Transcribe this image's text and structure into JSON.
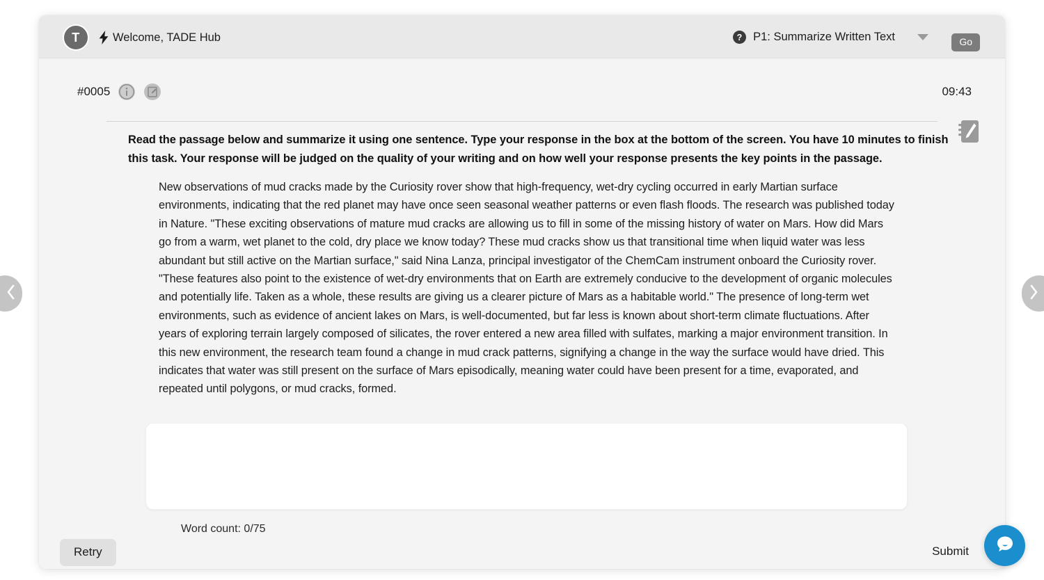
{
  "header": {
    "avatar_initial": "T",
    "bolt_icon": "lightning-bolt-icon",
    "welcome_text": "Welcome, TADE Hub",
    "help_icon": "help-circle-icon",
    "task_selected": "P1: Summarize Written Text",
    "dropdown_icon": "chevron-down-icon",
    "go_label": "Go"
  },
  "meta": {
    "item_id": "#0005",
    "info_icon": "info-circle-icon",
    "note_icon": "note-edit-icon",
    "timer": "09:43",
    "notepad_icon": "notepad-pencil-icon"
  },
  "task": {
    "instructions": "Read the passage below and summarize it using one sentence. Type your response in the box at the bottom of the screen. You have 10 minutes to finish this task. Your response will be judged on the quality of your writing and on how well your response presents the key points in the passage.",
    "passage": "New observations of mud cracks made by the Curiosity rover show that high-frequency, wet-dry cycling occurred in early Martian surface environments, indicating that the red planet may have once seen seasonal weather patterns or even flash floods. The research was published today in Nature. \"These exciting observations of mature mud cracks are allowing us to fill in some of the missing history of water on Mars. How did Mars go from a warm, wet planet to the cold, dry place we know today? These mud cracks show us that transitional time when liquid water was less abundant but still active on the Martian surface,\" said Nina Lanza, principal investigator of the ChemCam instrument onboard the Curiosity rover. \"These features also point to the existence of wet-dry environments that on Earth are extremely conducive to the development of organic molecules and potentially life. Taken as a whole, these results are giving us a clearer picture of Mars as a habitable world.\" The presence of long-term wet environments, such as evidence of ancient lakes on Mars, is well-documented, but far less is known about short-term climate fluctuations. After years of exploring terrain largely composed of silicates, the rover entered a new area filled with sulfates, marking a major environment transition. In this new environment, the research team found a change in mud crack patterns, signifying a change in the way the surface would have dried. This indicates that water was still present on the surface of Mars episodically, meaning water could have been present for a time, evaporated, and repeated until polygons, or mud cracks, formed."
  },
  "answer": {
    "value": "",
    "placeholder": "",
    "word_count": "Word count: 0/75"
  },
  "footer": {
    "retry_label": "Retry",
    "submit_label": "Submit"
  },
  "nav": {
    "prev_icon": "chevron-left-icon",
    "next_icon": "chevron-right-icon"
  },
  "chat": {
    "icon": "chat-bubble-icon",
    "color": "#1b8fce"
  },
  "colors": {
    "page_bg": "#ffffff",
    "card_bg": "#f4f4f4",
    "header_bg": "#e9e9e9",
    "go_button": "#7c7c7c",
    "retry_button": "#e0e0e0",
    "nav_arrow": "#c4c4c4",
    "text": "#1c1c1c"
  }
}
